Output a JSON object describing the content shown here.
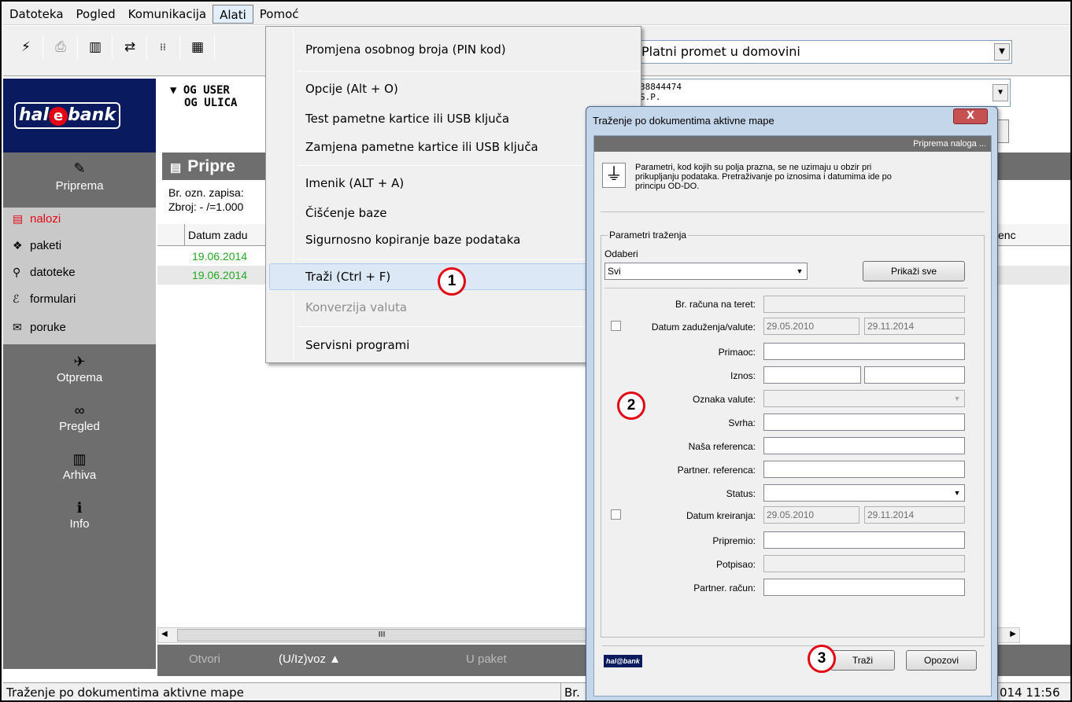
{
  "menubar": {
    "items": [
      "Datoteka",
      "Pogled",
      "Komunikacija",
      "Alati",
      "Pomoć"
    ]
  },
  "toolbar": {
    "payment_combo": "Platni promet u domovini",
    "account_line1": "38844474",
    "account_line2": "S.P."
  },
  "logo": {
    "text_left": "hal",
    "text_e": "e",
    "text_right": "bank"
  },
  "user": {
    "line1": "▼ OG USER",
    "line2": "OG ULICA"
  },
  "sidebar": {
    "header": "Priprema",
    "items": [
      {
        "label": "nalozi",
        "icon": "orders-icon"
      },
      {
        "label": "paketi",
        "icon": "packages-icon"
      },
      {
        "label": "datoteke",
        "icon": "files-icon"
      },
      {
        "label": "formulari",
        "icon": "forms-icon"
      },
      {
        "label": "poruke",
        "icon": "messages-icon"
      }
    ],
    "nav": [
      {
        "label": "Otprema",
        "icon": "send-icon"
      },
      {
        "label": "Pregled",
        "icon": "binoculars-icon"
      },
      {
        "label": "Arhiva",
        "icon": "archive-icon"
      },
      {
        "label": "Info",
        "icon": "info-icon"
      }
    ]
  },
  "main": {
    "panel_title": "Pripre",
    "info1": "Br. ozn. zapisa:",
    "info2": "Zbroj: - /=1.000",
    "col_date": "Datum zadu",
    "rows": [
      "19.06.2014",
      "19.06.2014"
    ],
    "right_col_fragment": "enc",
    "scroll_mark": "III"
  },
  "bottombar": {
    "open": "Otvori",
    "inout": "(U/Iz)voz ▲",
    "to_package": "U paket"
  },
  "status": {
    "text": "Traženje po dokumentima aktivne mape",
    "br_fragment": "Br.",
    "time_fragment": "014 11:56"
  },
  "alati_menu": {
    "items": [
      {
        "label": "Promjena osobnog broja (PIN kod)"
      },
      {
        "label": "Opcije (Alt + O)"
      },
      {
        "label": "Test pametne kartice ili USB ključa"
      },
      {
        "label": "Zamjena pametne kartice ili USB ključa"
      },
      {
        "label": "Imenik (ALT + A)"
      },
      {
        "label": "Čišćenje baze"
      },
      {
        "label": "Sigurnosno kopiranje baze podataka"
      },
      {
        "label": "Traži (Ctrl + F)"
      },
      {
        "label": "Konverzija valuta"
      },
      {
        "label": "Servisni programi"
      }
    ]
  },
  "badges": [
    "1",
    "2",
    "3"
  ],
  "dialog": {
    "title": "Traženje po dokumentima aktivne mape",
    "close": "X",
    "band": "Priprema naloga ...",
    "info_l1": "Parametri, kod kojih su polja prazna, se ne uzimaju u obzir pri",
    "info_l2": "prikupljanju podataka. Pretraživanje po iznosima i datumima ide po",
    "info_l3": "principu OD-DO.",
    "group_title": "Parametri traženja",
    "select_label": "Odaberi",
    "select_value": "Svi",
    "show_all": "Prikaži sve",
    "fields": {
      "account_debit": "Br. računa na teret:",
      "date_debit": "Datum zaduženja/valute:",
      "date_debit_from": "29.05.2010",
      "date_debit_to": "29.11.2014",
      "recipient": "Primaoc:",
      "amount": "Iznos:",
      "currency": "Oznaka valute:",
      "purpose": "Svrha:",
      "our_ref": "Naša referenca:",
      "partner_ref": "Partner. referenca:",
      "status": "Status:",
      "created": "Datum kreiranja:",
      "created_from": "29.05.2010",
      "created_to": "29.11.2014",
      "prepared": "Pripremio:",
      "signed": "Potpisao:",
      "partner_account": "Partner. račun:"
    },
    "search_btn": "Traži",
    "cancel_btn": "Opozovi",
    "footer_logo": "hal@bank"
  }
}
